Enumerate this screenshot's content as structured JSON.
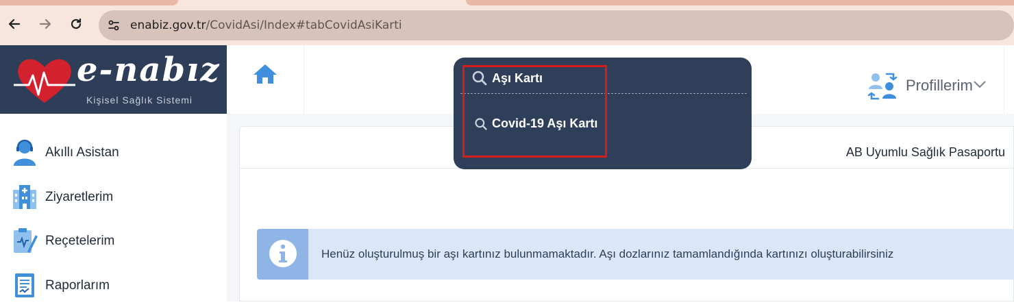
{
  "browser": {
    "url_host": "enabiz.gov.tr",
    "url_path": "/CovidAsi/Index#tabCovidAsiKarti",
    "back_icon": "arrow-left-icon",
    "forward_icon": "arrow-right-icon",
    "reload_icon": "reload-icon",
    "site_info_icon": "tune-icon"
  },
  "logo": {
    "title": "e-nabız",
    "subtitle": "Kişisel Sağlık Sistemi"
  },
  "header": {
    "home_icon": "home-icon",
    "profile_label": "Profillerim"
  },
  "search_dropdown": {
    "query": "Aşı Kartı",
    "results": [
      "Covid-19 Aşı Kartı"
    ]
  },
  "sidebar": {
    "items": [
      {
        "label": "Akıllı Asistan",
        "icon": "assistant-icon"
      },
      {
        "label": "Ziyaretlerim",
        "icon": "hospital-icon"
      },
      {
        "label": "Reçetelerim",
        "icon": "prescription-icon"
      },
      {
        "label": "Raporlarım",
        "icon": "report-icon"
      }
    ]
  },
  "main": {
    "panel_title": "AB Uyumlu Sağlık Pasaportu",
    "alert_text": "Henüz oluşturulmuş bir aşı kartınız bulunmamaktadır. Aşı dozlarınız tamamlandığında kartınızı oluşturabilirsiniz"
  },
  "colors": {
    "brand_navy": "#2e3e58",
    "accent_blue": "#3f8fdc",
    "alert_bg": "#dbe7f8",
    "highlight_red": "#d81c1c"
  }
}
